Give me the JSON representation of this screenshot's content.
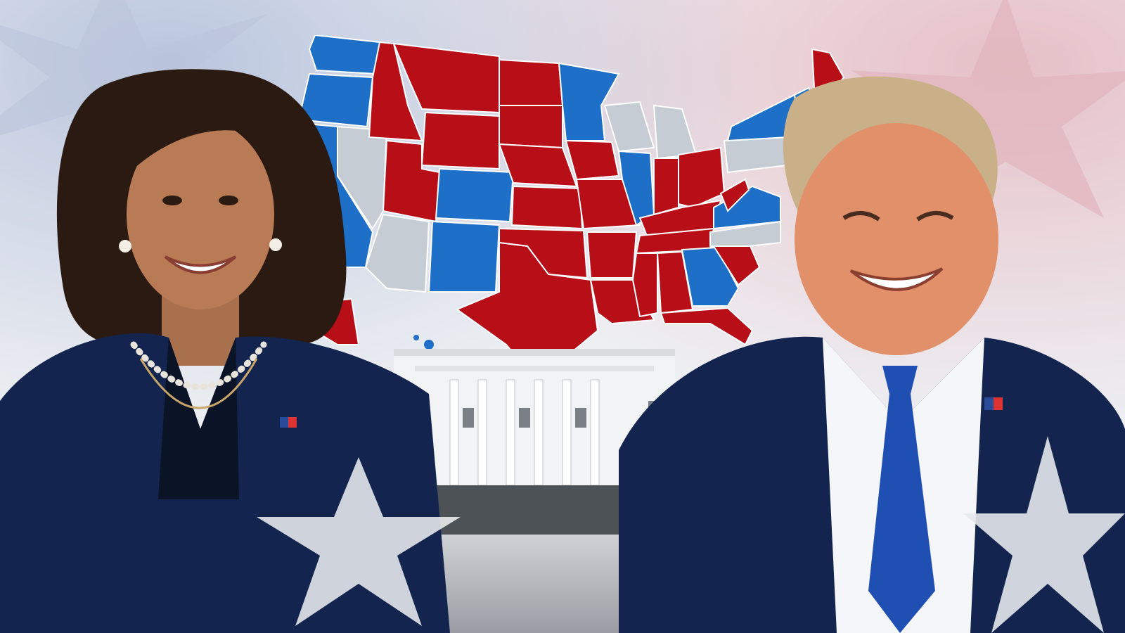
{
  "scene": {
    "colors": {
      "democrat": "#1e6fc8",
      "republican": "#b80e18",
      "tossup": "#c6ccd4",
      "suit_navy": "#13254f",
      "tie_blue": "#1f4fb3"
    },
    "elements": {
      "map": "us-electoral-map",
      "building": "white-house",
      "left_figure": "woman-in-navy-suit-with-pearl-necklace",
      "right_figure": "man-in-navy-suit-with-blue-tie",
      "decor": "star-shapes"
    }
  }
}
